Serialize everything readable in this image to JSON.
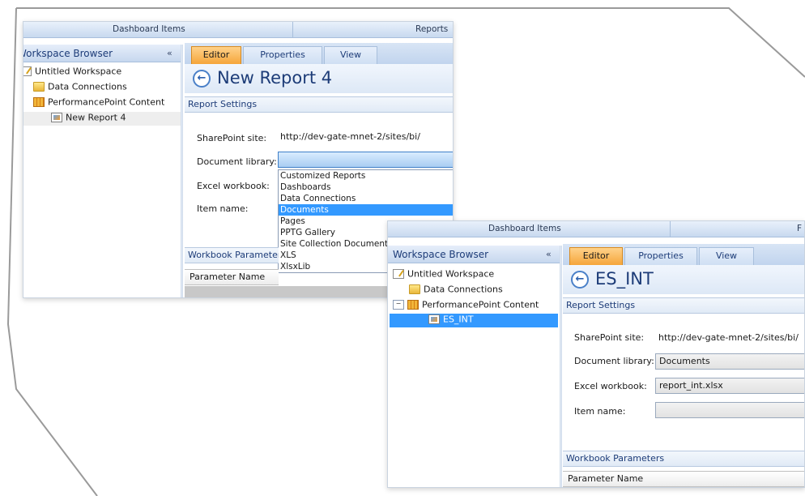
{
  "back": {
    "ribbon": {
      "dashboard_items": "Dashboard Items",
      "reports": "Reports"
    },
    "workspace_browser": {
      "title": "Workspace Browser",
      "collapse": "«"
    },
    "tree": [
      {
        "label": "Untitled Workspace",
        "icon": "workspace-icon"
      },
      {
        "label": "Data Connections",
        "icon": "folder-icon"
      },
      {
        "label": "PerformancePoint Content",
        "icon": "performancepoint-content-icon"
      },
      {
        "label": "New Report 4",
        "icon": "report-icon"
      }
    ],
    "tabs": [
      "Editor",
      "Properties",
      "View"
    ],
    "report_title": "New Report 4",
    "section": "Report Settings",
    "fields": {
      "sharepoint_site_label": "SharePoint site:",
      "sharepoint_site_value": "http://dev-gate-mnet-2/sites/bi/",
      "document_library_label": "Document library:",
      "excel_workbook_label": "Excel workbook:",
      "item_name_label": "Item name:"
    },
    "dropdown_options": [
      "Customized Reports",
      "Dashboards",
      "Data Connections",
      "Documents",
      "Pages",
      "PPTG Gallery",
      "Site Collection Documents",
      "XLS",
      "XlsxLib"
    ],
    "dropdown_selected": "Documents",
    "workbook_parameters": "Workbook Parameter",
    "parameter_name": "Parameter Name"
  },
  "front": {
    "ribbon": {
      "dashboard_items": "Dashboard Items",
      "reports_partial": "F"
    },
    "workspace_browser": {
      "title": "Workspace Browser",
      "collapse": "«"
    },
    "tree": [
      {
        "label": "Untitled Workspace",
        "icon": "workspace-icon"
      },
      {
        "label": "Data Connections",
        "icon": "folder-icon"
      },
      {
        "label": "PerformancePoint Content",
        "icon": "performancepoint-content-icon",
        "expander": "−"
      },
      {
        "label": "ES_INT",
        "icon": "report-icon"
      }
    ],
    "tabs": [
      "Editor",
      "Properties",
      "View"
    ],
    "report_title": "ES_INT",
    "section": "Report Settings",
    "fields": {
      "sharepoint_site_label": "SharePoint site:",
      "sharepoint_site_value": "http://dev-gate-mnet-2/sites/bi/",
      "document_library_label": "Document library:",
      "document_library_value": "Documents",
      "excel_workbook_label": "Excel workbook:",
      "excel_workbook_value": "report_int.xlsx",
      "item_name_label": "Item name:",
      "item_name_value": ""
    },
    "workbook_parameters": "Workbook Parameters",
    "parameter_name": "Parameter Name"
  }
}
